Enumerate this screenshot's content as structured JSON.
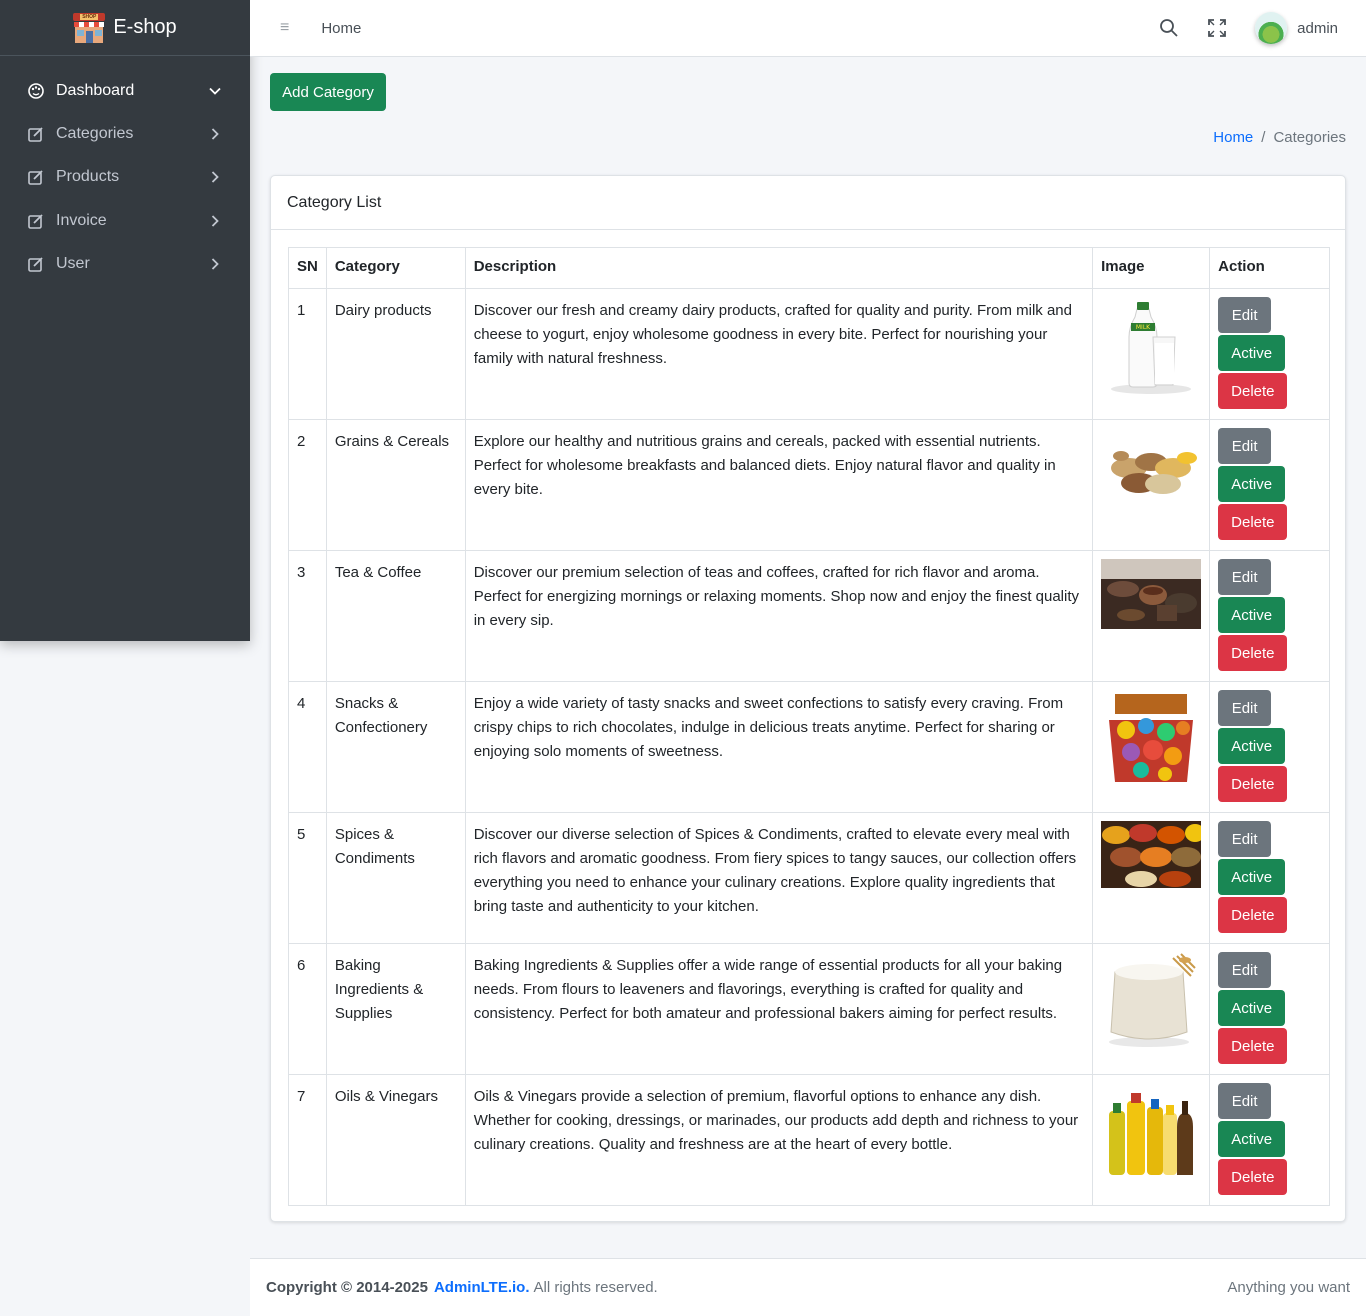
{
  "brand": {
    "name": "E-shop",
    "logo_text": "SHOP"
  },
  "sidebar": {
    "items": [
      {
        "label": "Dashboard",
        "icon": "palette-icon",
        "expanded": true
      },
      {
        "label": "Categories",
        "icon": "edit-icon"
      },
      {
        "label": "Products",
        "icon": "edit-icon"
      },
      {
        "label": "Invoice",
        "icon": "edit-icon"
      },
      {
        "label": "User",
        "icon": "edit-icon"
      }
    ]
  },
  "topbar": {
    "menu_icon": "≡",
    "home_label": "Home",
    "user_name": "admin"
  },
  "page": {
    "add_button": "Add Category",
    "breadcrumb": {
      "home": "Home",
      "separator": "/",
      "current": "Categories"
    }
  },
  "card": {
    "title": "Category List",
    "columns": [
      "SN",
      "Category",
      "Description",
      "Image",
      "Action"
    ],
    "actions": {
      "edit": "Edit",
      "active": "Active",
      "delete": "Delete"
    },
    "rows": [
      {
        "sn": "1",
        "category": "Dairy products",
        "description": "Discover our fresh and creamy dairy products, crafted for quality and purity. From milk and cheese to yogurt, enjoy wholesome goodness in every bite. Perfect for nourishing your family with natural freshness.",
        "image": "milk-image",
        "milk_label": "MILK"
      },
      {
        "sn": "2",
        "category": "Grains & Cereals",
        "description": "Explore our healthy and nutritious grains and cereals, packed with essential nutrients. Perfect for wholesome breakfasts and balanced diets. Enjoy natural flavor and quality in every bite.",
        "image": "grains-image"
      },
      {
        "sn": "3",
        "category": "Tea & Coffee",
        "description": "Discover our premium selection of teas and coffees, crafted for rich flavor and aroma. Perfect for energizing mornings or relaxing moments. Shop now and enjoy the finest quality in every sip.",
        "image": "tea-coffee-image"
      },
      {
        "sn": "4",
        "category": "Snacks & Confectionery",
        "description": "Enjoy a wide variety of tasty snacks and sweet confections to satisfy every craving. From crispy chips to rich chocolates, indulge in delicious treats anytime. Perfect for sharing or enjoying solo moments of sweetness.",
        "image": "snacks-image"
      },
      {
        "sn": "5",
        "category": "Spices & Condiments",
        "description": "Discover our diverse selection of Spices & Condiments, crafted to elevate every meal with rich flavors and aromatic goodness. From fiery spices to tangy sauces, our collection offers everything you need to enhance your culinary creations. Explore quality ingredients that bring taste and authenticity to your kitchen.",
        "image": "spices-image"
      },
      {
        "sn": "6",
        "category": "Baking Ingredients & Supplies",
        "description": "Baking Ingredients & Supplies offer a wide range of essential products for all your baking needs. From flours to leaveners and flavorings, everything is crafted for quality and consistency. Perfect for both amateur and professional bakers aiming for perfect results.",
        "image": "flour-sack-image"
      },
      {
        "sn": "7",
        "category": "Oils & Vinegars",
        "description": "Oils & Vinegars provide a selection of premium, flavorful options to enhance any dish. Whether for cooking, dressings, or marinades, our products add depth and richness to your culinary creations. Quality and freshness are at the heart of every bottle.",
        "image": "oil-bottles-image"
      }
    ]
  },
  "footer": {
    "copyright": "Copyright © 2014-2025",
    "link": "AdminLTE.io.",
    "rights": "All rights reserved.",
    "right_text": "Anything you want"
  },
  "colors": {
    "sidebar_bg": "#343a40",
    "primary_link": "#0d6efd",
    "success": "#198754",
    "secondary": "#6c757d",
    "danger": "#dc3545"
  }
}
